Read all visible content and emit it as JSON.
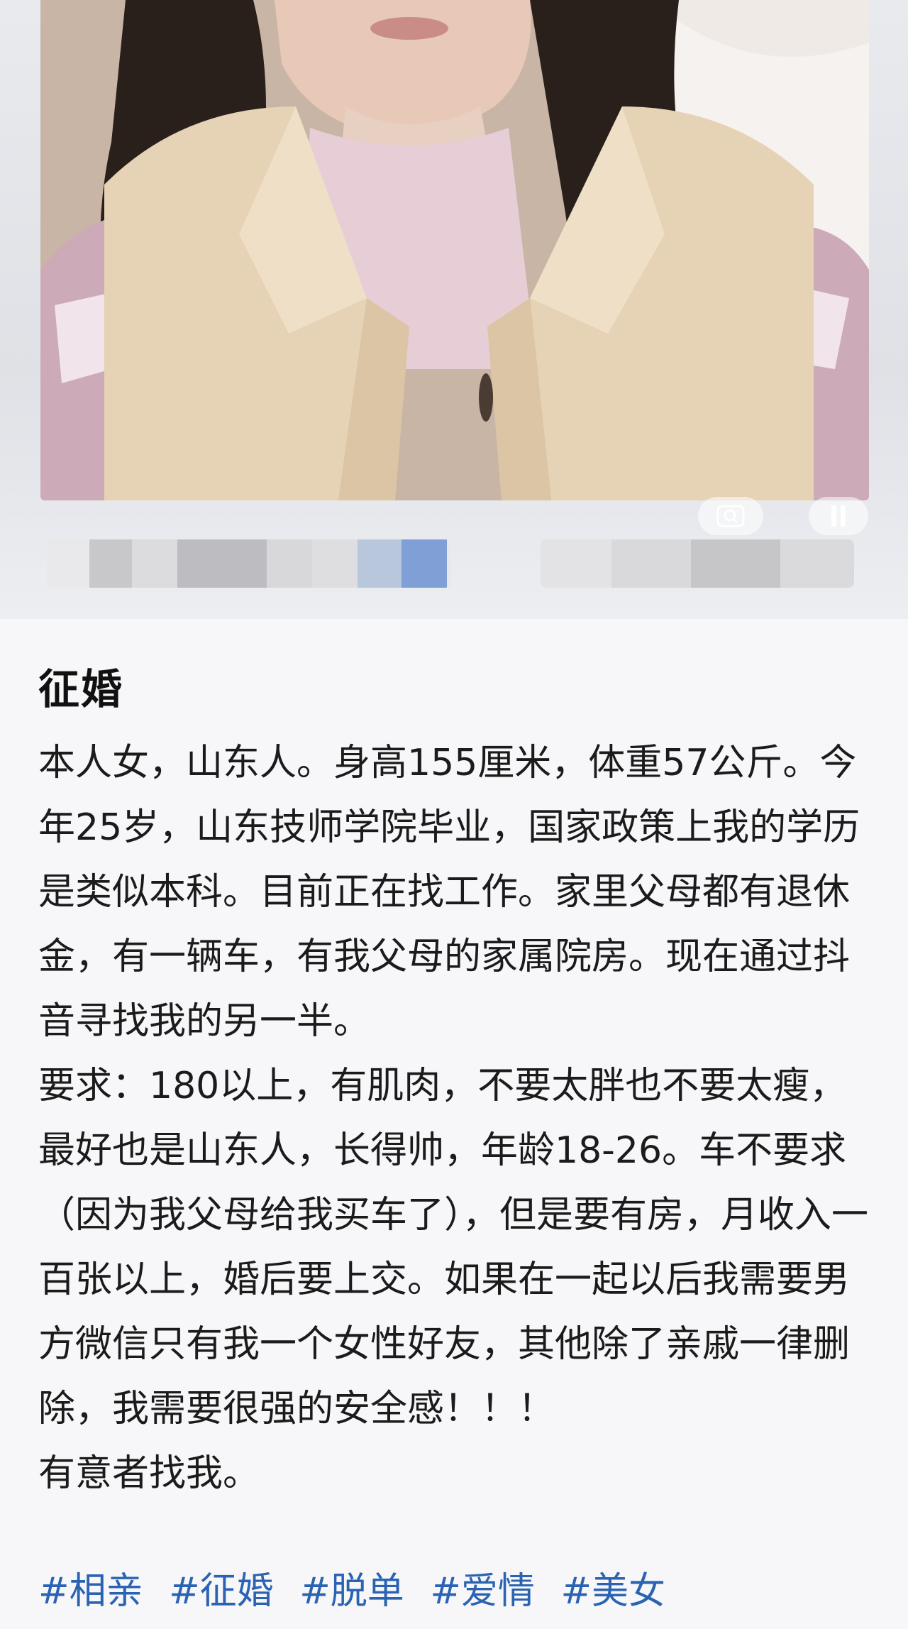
{
  "post": {
    "title": "征婚",
    "paragraphs": [
      "本人女，山东人。身高155厘米，体重57公斤。今年25岁，山东技师学院毕业，国家政策上我的学历是类似本科。目前正在找工作。家里父母都有退休金，有一辆车，有我父母的家属院房。现在通过抖音寻找我的另一半。",
      "要求：180以上，有肌肉，不要太胖也不要太瘦，最好也是山东人，长得帅，年龄18-26。车不要求（因为我父母给我买车了），但是要有房，月收入一百张以上，婚后要上交。如果在一起以后我需要男方微信只有我一个女性好友，其他除了亲戚一律删除，我需要很强的安全感！！！",
      "有意者找我。"
    ],
    "tags": [
      "#相亲",
      "#征婚",
      "#脱单",
      "#爱情",
      "#美女"
    ]
  },
  "media": {
    "zoom_icon": "zoom-search-icon",
    "pause_icon": "pause-icon"
  },
  "colors": {
    "tag": "#2b63b3",
    "background": "#f7f7f9"
  }
}
